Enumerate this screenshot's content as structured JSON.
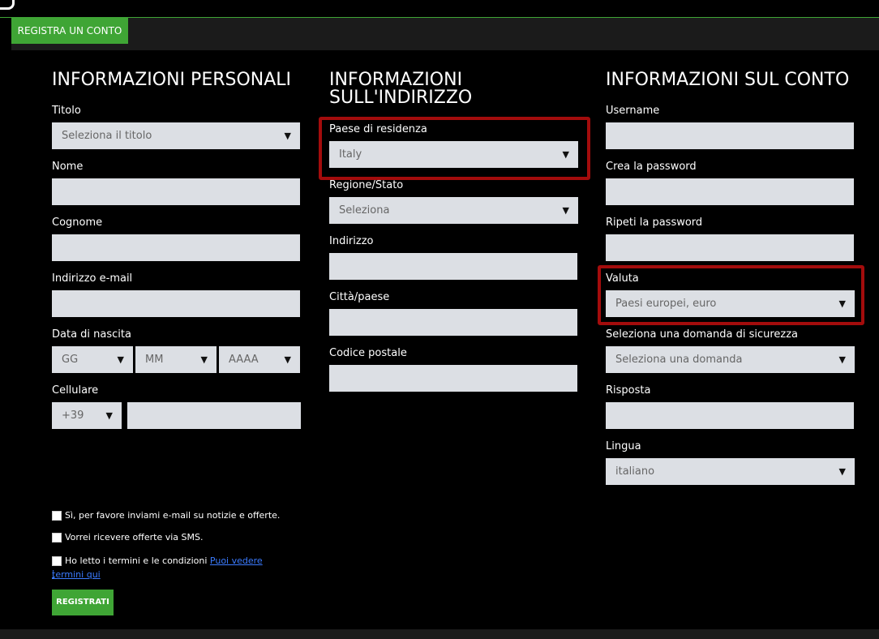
{
  "header": {
    "tab_label": "REGISTRA UN CONTO"
  },
  "sections": {
    "personal": {
      "title": "INFORMAZIONI PERSONALI",
      "titolo_label": "Titolo",
      "titolo_value": "Seleziona il titolo",
      "nome_label": "Nome",
      "cognome_label": "Cognome",
      "email_label": "Indirizzo e-mail",
      "dob_label": "Data di nascita",
      "dob_day": "GG",
      "dob_month": "MM",
      "dob_year": "AAAA",
      "cell_label": "Cellulare",
      "cell_prefix": "+39"
    },
    "address": {
      "title_line1": "INFORMAZIONI",
      "title_line2": "SULL'INDIRIZZO",
      "paese_label": "Paese di residenza",
      "paese_value": "Italy",
      "regione_label": "Regione/Stato",
      "regione_value": "Seleziona",
      "indirizzo_label": "Indirizzo",
      "citta_label": "Città/paese",
      "cap_label": "Codice postale"
    },
    "account": {
      "title": "INFORMAZIONI SUL CONTO",
      "username_label": "Username",
      "password_label": "Crea la password",
      "password_repeat_label": "Ripeti la password",
      "valuta_label": "Valuta",
      "valuta_value": "Paesi europei, euro",
      "security_label": "Seleziona una domanda di sicurezza",
      "security_value": "Seleziona una domanda",
      "risposta_label": "Risposta",
      "lingua_label": "Lingua",
      "lingua_value": "italiano"
    }
  },
  "consents": {
    "news_email": "Sì, per favore inviami e-mail su notizie e offerte.",
    "sms": "Vorrei ricevere offerte via SMS.",
    "terms_text": "Ho letto i termini e le condizioni",
    "terms_link_1": "Puoi vedere i",
    "terms_link_2": "termini qui"
  },
  "actions": {
    "register_label": "REGISTRATI"
  },
  "colors": {
    "accent": "#3fa535",
    "highlight": "#a30c0c",
    "field_bg": "#dcdfe4"
  }
}
